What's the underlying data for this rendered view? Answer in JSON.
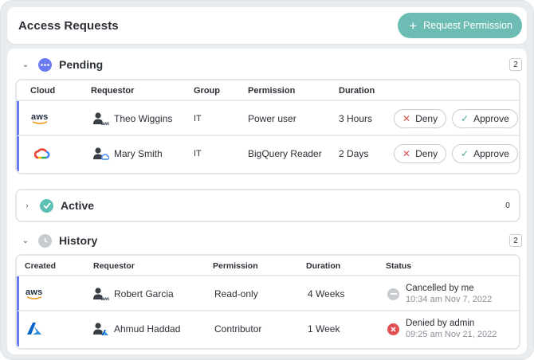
{
  "app": {
    "title": "Access Requests",
    "request_button": "Request Permission",
    "accent": "#6cbcb4"
  },
  "pending": {
    "title": "Pending",
    "count": "2",
    "columns": [
      "Cloud",
      "Requestor",
      "Group",
      "Permission",
      "Duration"
    ],
    "rows": [
      {
        "cloud": "aws",
        "requestor": "Theo Wiggins",
        "group": "IT",
        "permission": "Power user",
        "duration": "3 Hours",
        "deny": "Deny",
        "approve": "Approve"
      },
      {
        "cloud": "gcp",
        "requestor": "Mary Smith",
        "group": "IT",
        "permission": "BigQuery Reader",
        "duration": "2 Days",
        "deny": "Deny",
        "approve": "Approve"
      }
    ]
  },
  "active": {
    "title": "Active",
    "count": "0"
  },
  "history": {
    "title": "History",
    "count": "2",
    "columns": [
      "Created",
      "Requestor",
      "Permission",
      "Duration",
      "Status"
    ],
    "rows": [
      {
        "cloud": "aws",
        "requestor": "Robert Garcia",
        "permission": "Read-only",
        "duration": "4 Weeks",
        "status": "Cancelled by me",
        "status_time": "10:34 am Nov 7, 2022",
        "status_icon": "minus-circle-icon"
      },
      {
        "cloud": "azure",
        "requestor": "Ahmud Haddad",
        "permission": "Contributor",
        "duration": "1 Week",
        "status": "Denied by admin",
        "status_time": "09:25 am Nov 21, 2022",
        "status_icon": "x-circle-icon"
      }
    ]
  },
  "labels": {
    "aws": "aws"
  },
  "colors": {
    "pending": "#6b7cf2",
    "active": "#5cc0b4",
    "history": "#c8ccd1",
    "deny": "#e05252",
    "approve": "#4aa79c"
  }
}
